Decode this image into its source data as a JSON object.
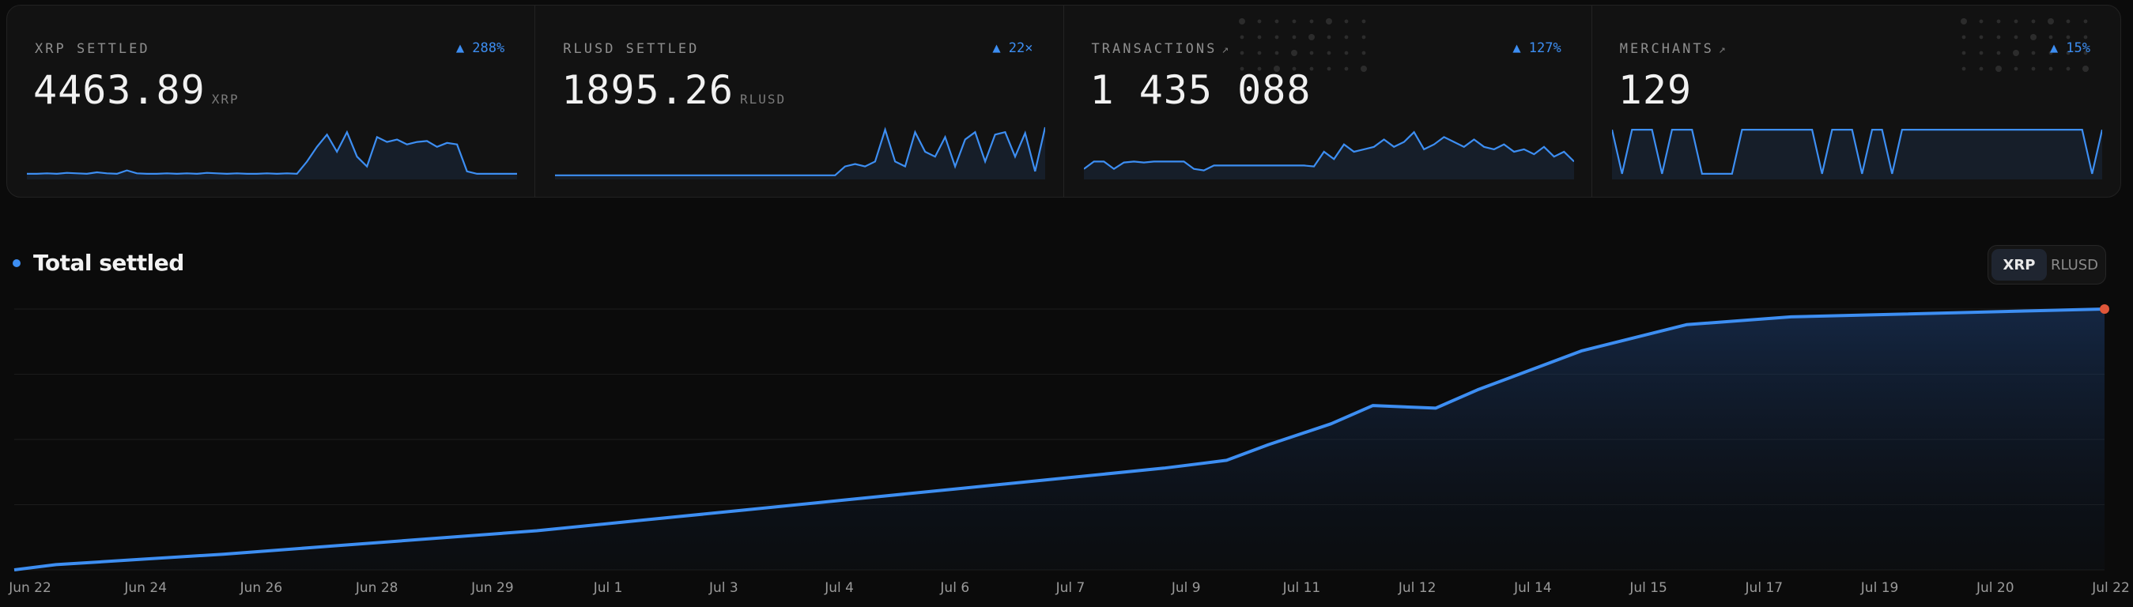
{
  "stats": [
    {
      "label": "XRP SETTLED",
      "arrow": "",
      "badge": "▲ 288%",
      "value": "4463.89",
      "unit": "XRP"
    },
    {
      "label": "RLUSD SETTLED",
      "arrow": "",
      "badge": "▲ 22×",
      "value": "1895.26",
      "unit": "RLUSD"
    },
    {
      "label": "TRANSACTIONS",
      "arrow": "↗",
      "badge": "▲ 127%",
      "value": "1 435 088",
      "unit": ""
    },
    {
      "label": "MERCHANTS",
      "arrow": "↗",
      "badge": "▲ 15%",
      "value": "129",
      "unit": ""
    }
  ],
  "chart": {
    "title": "Total settled",
    "toggle": {
      "options": [
        "XRP",
        "RLUSD"
      ],
      "selected": "XRP"
    }
  },
  "colors": {
    "accent": "#3d8ef2",
    "marker": "#e0573a",
    "background": "#0b0b0b"
  },
  "chart_data": {
    "type": "area",
    "title": "Total settled",
    "x_ticks": [
      "Jun 22",
      "Jun 24",
      "Jun 26",
      "Jun 28",
      "Jun 29",
      "Jul 1",
      "Jul 3",
      "Jul 4",
      "Jul 6",
      "Jul 7",
      "Jul 9",
      "Jul 11",
      "Jul 12",
      "Jul 14",
      "Jul 15",
      "Jul 17",
      "Jul 19",
      "Jul 20",
      "Jul 22"
    ],
    "x": [
      0,
      0.02,
      0.06,
      0.1,
      0.15,
      0.2,
      0.25,
      0.3,
      0.35,
      0.4,
      0.45,
      0.5,
      0.55,
      0.58,
      0.6,
      0.63,
      0.65,
      0.68,
      0.7,
      0.75,
      0.8,
      0.85,
      0.9,
      1.0
    ],
    "y": [
      0,
      0.02,
      0.04,
      0.06,
      0.09,
      0.12,
      0.15,
      0.19,
      0.23,
      0.27,
      0.31,
      0.35,
      0.39,
      0.42,
      0.48,
      0.56,
      0.63,
      0.62,
      0.69,
      0.84,
      0.94,
      0.97,
      0.98,
      1.0
    ],
    "ylim": [
      0,
      1
    ],
    "grid": true,
    "sparklines": [
      [
        0.05,
        0.05,
        0.06,
        0.05,
        0.07,
        0.06,
        0.05,
        0.08,
        0.06,
        0.05,
        0.12,
        0.06,
        0.05,
        0.05,
        0.06,
        0.05,
        0.06,
        0.05,
        0.07,
        0.06,
        0.05,
        0.06,
        0.05,
        0.05,
        0.06,
        0.05,
        0.06,
        0.05,
        0.3,
        0.6,
        0.85,
        0.5,
        0.9,
        0.4,
        0.2,
        0.8,
        0.7,
        0.75,
        0.65,
        0.7,
        0.72,
        0.6,
        0.68,
        0.65,
        0.1,
        0.05,
        0.05,
        0.05,
        0.05,
        0.05
      ],
      [
        0.02,
        0.02,
        0.02,
        0.02,
        0.02,
        0.02,
        0.02,
        0.02,
        0.02,
        0.02,
        0.02,
        0.02,
        0.02,
        0.02,
        0.02,
        0.02,
        0.02,
        0.02,
        0.02,
        0.02,
        0.02,
        0.02,
        0.02,
        0.02,
        0.02,
        0.02,
        0.02,
        0.02,
        0.02,
        0.2,
        0.25,
        0.2,
        0.3,
        0.95,
        0.3,
        0.2,
        0.9,
        0.5,
        0.4,
        0.8,
        0.2,
        0.75,
        0.9,
        0.3,
        0.85,
        0.9,
        0.4,
        0.88,
        0.1,
        1.0
      ],
      [
        0.15,
        0.3,
        0.3,
        0.15,
        0.28,
        0.3,
        0.28,
        0.3,
        0.3,
        0.3,
        0.3,
        0.15,
        0.12,
        0.22,
        0.22,
        0.22,
        0.22,
        0.22,
        0.22,
        0.22,
        0.22,
        0.22,
        0.22,
        0.2,
        0.5,
        0.35,
        0.65,
        0.5,
        0.55,
        0.6,
        0.75,
        0.6,
        0.7,
        0.9,
        0.55,
        0.65,
        0.8,
        0.7,
        0.6,
        0.75,
        0.6,
        0.55,
        0.65,
        0.5,
        0.55,
        0.45,
        0.6,
        0.4,
        0.5,
        0.3
      ],
      [
        0.95,
        0.05,
        0.95,
        0.95,
        0.95,
        0.05,
        0.95,
        0.95,
        0.95,
        0.05,
        0.05,
        0.05,
        0.05,
        0.95,
        0.95,
        0.95,
        0.95,
        0.95,
        0.95,
        0.95,
        0.95,
        0.05,
        0.95,
        0.95,
        0.95,
        0.05,
        0.95,
        0.95,
        0.05,
        0.95,
        0.95,
        0.95,
        0.95,
        0.95,
        0.95,
        0.95,
        0.95,
        0.95,
        0.95,
        0.95,
        0.95,
        0.95,
        0.95,
        0.95,
        0.95,
        0.95,
        0.95,
        0.95,
        0.05,
        0.95
      ]
    ]
  }
}
